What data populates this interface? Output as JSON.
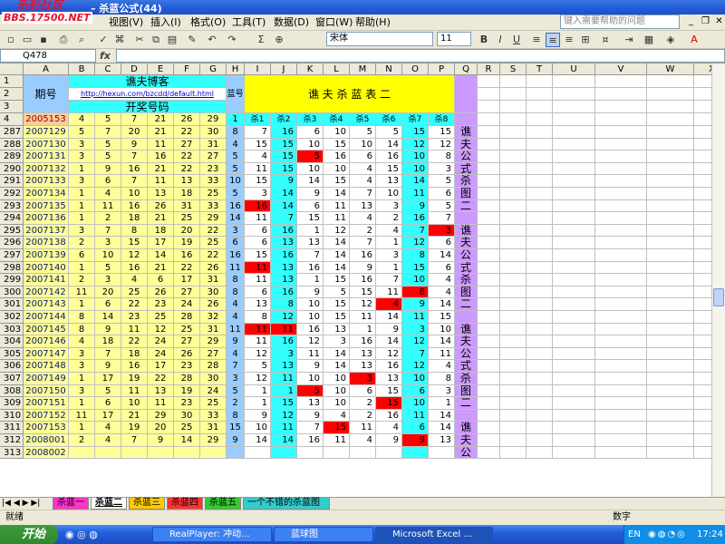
{
  "window": {
    "title": "– 杀蓝公式(44)"
  },
  "logo": {
    "line1": "乐彩社区",
    "line2": "BBS.17500.NET"
  },
  "menu": [
    {
      "id": "view",
      "label": "视图(V)"
    },
    {
      "id": "insert",
      "label": "插入(I)"
    },
    {
      "id": "format",
      "label": "格式(O)"
    },
    {
      "id": "tools",
      "label": "工具(T)"
    },
    {
      "id": "data",
      "label": "数据(D)"
    },
    {
      "id": "window",
      "label": "窗口(W)"
    },
    {
      "id": "help",
      "label": "帮助(H)"
    }
  ],
  "help_placeholder": "键入需要帮助的问题",
  "font_name": "宋体",
  "font_size": "11",
  "name_box": "Q478",
  "fx_label": "fx",
  "columns": [
    "A",
    "B",
    "C",
    "D",
    "E",
    "F",
    "G",
    "H",
    "I",
    "J",
    "K",
    "L",
    "M",
    "N",
    "O",
    "P",
    "Q",
    "R",
    "S",
    "T",
    "U",
    "V",
    "W",
    "X"
  ],
  "header": {
    "period": "期号",
    "blog_title": "谯夫博客",
    "blog_url": "http://hexun.com/bzcdd/default.html",
    "draw_numbers": "开奖号码",
    "blue": "蓝号",
    "table_title": "谯 夫 杀 蓝 表 二",
    "row_labels": [
      "1",
      "2",
      "3",
      "4"
    ]
  },
  "row4": {
    "row": "4",
    "period": "2005153",
    "nums": [
      "4",
      "5",
      "7",
      "21",
      "26",
      "29"
    ],
    "blue": "1",
    "kill_headers": [
      "杀1",
      "杀2",
      "杀3",
      "杀4",
      "杀5",
      "杀6",
      "杀7",
      "杀8"
    ]
  },
  "rows": [
    {
      "row": "287",
      "period": "2007129",
      "nums": [
        "5",
        "7",
        "20",
        "21",
        "22",
        "30"
      ],
      "blue": "8",
      "kills": [
        "7",
        "16",
        "6",
        "10",
        "5",
        "5",
        "15",
        "15"
      ],
      "red": []
    },
    {
      "row": "288",
      "period": "2007130",
      "nums": [
        "3",
        "5",
        "9",
        "11",
        "27",
        "31"
      ],
      "blue": "4",
      "kills": [
        "15",
        "15",
        "10",
        "15",
        "10",
        "14",
        "12",
        "12"
      ],
      "red": []
    },
    {
      "row": "289",
      "period": "2007131",
      "nums": [
        "3",
        "5",
        "7",
        "16",
        "22",
        "27"
      ],
      "blue": "5",
      "kills": [
        "4",
        "15",
        "5",
        "16",
        "6",
        "16",
        "10",
        "8"
      ],
      "red": [
        2
      ]
    },
    {
      "row": "290",
      "period": "2007132",
      "nums": [
        "1",
        "9",
        "16",
        "21",
        "22",
        "23"
      ],
      "blue": "5",
      "kills": [
        "11",
        "15",
        "10",
        "10",
        "4",
        "15",
        "10",
        "3"
      ],
      "red": []
    },
    {
      "row": "291",
      "period": "2007133",
      "nums": [
        "3",
        "6",
        "7",
        "11",
        "13",
        "33"
      ],
      "blue": "10",
      "kills": [
        "15",
        "9",
        "14",
        "15",
        "4",
        "13",
        "14",
        "5"
      ],
      "red": []
    },
    {
      "row": "292",
      "period": "2007134",
      "nums": [
        "1",
        "4",
        "10",
        "13",
        "18",
        "25"
      ],
      "blue": "5",
      "kills": [
        "3",
        "14",
        "9",
        "14",
        "7",
        "10",
        "11",
        "6"
      ],
      "red": []
    },
    {
      "row": "293",
      "period": "2007135",
      "nums": [
        "1",
        "11",
        "16",
        "26",
        "31",
        "33"
      ],
      "blue": "16",
      "kills": [
        "16",
        "14",
        "6",
        "11",
        "13",
        "3",
        "9",
        "5"
      ],
      "red": [
        0
      ]
    },
    {
      "row": "294",
      "period": "2007136",
      "nums": [
        "1",
        "2",
        "18",
        "21",
        "25",
        "29"
      ],
      "blue": "14",
      "kills": [
        "11",
        "7",
        "15",
        "11",
        "4",
        "2",
        "16",
        "7"
      ],
      "red": []
    },
    {
      "row": "295",
      "period": "2007137",
      "nums": [
        "3",
        "7",
        "8",
        "18",
        "20",
        "22"
      ],
      "blue": "3",
      "kills": [
        "6",
        "16",
        "1",
        "12",
        "2",
        "4",
        "7",
        "3"
      ],
      "red": [
        7
      ]
    },
    {
      "row": "296",
      "period": "2007138",
      "nums": [
        "2",
        "3",
        "15",
        "17",
        "19",
        "25"
      ],
      "blue": "6",
      "kills": [
        "6",
        "13",
        "13",
        "14",
        "7",
        "1",
        "12",
        "6"
      ],
      "red": []
    },
    {
      "row": "297",
      "period": "2007139",
      "nums": [
        "6",
        "10",
        "12",
        "14",
        "16",
        "22"
      ],
      "blue": "16",
      "kills": [
        "15",
        "16",
        "7",
        "14",
        "16",
        "3",
        "8",
        "14"
      ],
      "red": []
    },
    {
      "row": "298",
      "period": "2007140",
      "nums": [
        "1",
        "5",
        "16",
        "21",
        "22",
        "26"
      ],
      "blue": "11",
      "kills": [
        "11",
        "13",
        "16",
        "14",
        "9",
        "1",
        "15",
        "6"
      ],
      "red": [
        0
      ]
    },
    {
      "row": "299",
      "period": "2007141",
      "nums": [
        "2",
        "3",
        "4",
        "6",
        "17",
        "31"
      ],
      "blue": "8",
      "kills": [
        "11",
        "13",
        "1",
        "15",
        "16",
        "7",
        "10",
        "4"
      ],
      "red": []
    },
    {
      "row": "300",
      "period": "2007142",
      "nums": [
        "11",
        "20",
        "25",
        "26",
        "27",
        "30"
      ],
      "blue": "8",
      "kills": [
        "6",
        "16",
        "9",
        "5",
        "15",
        "11",
        "8",
        "4"
      ],
      "red": [
        6
      ]
    },
    {
      "row": "301",
      "period": "2007143",
      "nums": [
        "1",
        "6",
        "22",
        "23",
        "24",
        "26"
      ],
      "blue": "4",
      "kills": [
        "13",
        "8",
        "10",
        "15",
        "12",
        "4",
        "9",
        "14"
      ],
      "red": [
        5
      ]
    },
    {
      "row": "302",
      "period": "2007144",
      "nums": [
        "8",
        "14",
        "23",
        "25",
        "28",
        "32"
      ],
      "blue": "4",
      "kills": [
        "8",
        "12",
        "10",
        "15",
        "11",
        "14",
        "11",
        "15"
      ],
      "red": []
    },
    {
      "row": "303",
      "period": "2007145",
      "nums": [
        "8",
        "9",
        "11",
        "12",
        "25",
        "31"
      ],
      "blue": "11",
      "kills": [
        "11",
        "11",
        "16",
        "13",
        "1",
        "9",
        "3",
        "10"
      ],
      "red": [
        0,
        1
      ]
    },
    {
      "row": "304",
      "period": "2007146",
      "nums": [
        "4",
        "18",
        "22",
        "24",
        "27",
        "29"
      ],
      "blue": "9",
      "kills": [
        "11",
        "16",
        "12",
        "3",
        "16",
        "14",
        "12",
        "14"
      ],
      "red": []
    },
    {
      "row": "305",
      "period": "2007147",
      "nums": [
        "3",
        "7",
        "18",
        "24",
        "26",
        "27"
      ],
      "blue": "4",
      "kills": [
        "12",
        "3",
        "11",
        "14",
        "13",
        "12",
        "7",
        "11"
      ],
      "red": []
    },
    {
      "row": "306",
      "period": "2007148",
      "nums": [
        "3",
        "9",
        "16",
        "17",
        "23",
        "28"
      ],
      "blue": "7",
      "kills": [
        "5",
        "13",
        "9",
        "14",
        "13",
        "16",
        "12",
        "4"
      ],
      "red": []
    },
    {
      "row": "307",
      "period": "2007149",
      "nums": [
        "1",
        "17",
        "19",
        "22",
        "28",
        "30"
      ],
      "blue": "3",
      "kills": [
        "12",
        "11",
        "10",
        "10",
        "3",
        "13",
        "10",
        "8"
      ],
      "red": [
        4
      ]
    },
    {
      "row": "308",
      "period": "2007150",
      "nums": [
        "3",
        "5",
        "11",
        "13",
        "19",
        "24"
      ],
      "blue": "5",
      "kills": [
        "1",
        "1",
        "5",
        "10",
        "6",
        "15",
        "6",
        "3"
      ],
      "red": [
        2
      ]
    },
    {
      "row": "309",
      "period": "2007151",
      "nums": [
        "1",
        "6",
        "10",
        "11",
        "23",
        "25"
      ],
      "blue": "2",
      "kills": [
        "1",
        "15",
        "13",
        "10",
        "2",
        "15",
        "10",
        "1"
      ],
      "red": [
        5
      ]
    },
    {
      "row": "310",
      "period": "2007152",
      "nums": [
        "11",
        "17",
        "21",
        "29",
        "30",
        "33"
      ],
      "blue": "8",
      "kills": [
        "9",
        "12",
        "9",
        "4",
        "2",
        "16",
        "11",
        "14"
      ],
      "red": []
    },
    {
      "row": "311",
      "period": "2007153",
      "nums": [
        "1",
        "4",
        "19",
        "20",
        "25",
        "31"
      ],
      "blue": "15",
      "kills": [
        "10",
        "11",
        "7",
        "15",
        "11",
        "4",
        "6",
        "14"
      ],
      "red": [
        3
      ]
    },
    {
      "row": "312",
      "period": "2008001",
      "nums": [
        "2",
        "4",
        "7",
        "9",
        "14",
        "29"
      ],
      "blue": "9",
      "kills": [
        "14",
        "14",
        "16",
        "11",
        "4",
        "9",
        "9",
        "13"
      ],
      "red": [
        6
      ]
    },
    {
      "row": "313",
      "period": "2008002",
      "nums": [
        "",
        "",
        "",
        "",
        "",
        "",
        ""
      ],
      "blue": "",
      "kills": [
        "",
        "",
        "",
        "",
        "",
        "",
        "",
        ""
      ],
      "red": []
    }
  ],
  "side_text": [
    "谯",
    "夫",
    "公",
    "式",
    "杀",
    "图",
    "二",
    "",
    "谯",
    "夫",
    "公",
    "式",
    "杀",
    "图",
    "二",
    "",
    "谯",
    "夫",
    "公",
    "式",
    "杀",
    "图",
    "二",
    "",
    "谯",
    "夫",
    "公"
  ],
  "sheet_tabs": [
    {
      "label": "杀蓝一",
      "color": "#ff33cc"
    },
    {
      "label": "杀蓝二",
      "color": "#ffffff"
    },
    {
      "label": "杀蓝三",
      "color": "#ffcc00"
    },
    {
      "label": "杀蓝四",
      "color": "#ff3333"
    },
    {
      "label": "杀蓝五",
      "color": "#33cc33"
    },
    {
      "label": "一个不错的杀蓝图",
      "color": "#33cccc"
    }
  ],
  "status": {
    "left": "就绪",
    "right": "数字"
  },
  "taskbar": {
    "start": "开始",
    "tasks": [
      {
        "label": "RealPlayer: 冲动..."
      },
      {
        "label": "蓝球图"
      },
      {
        "label": "Microsoft Excel ..."
      }
    ],
    "lang": "EN",
    "clock": "17:24"
  },
  "colors": {
    "yellow": "#ffff99",
    "cyan": "#33ffff",
    "teal": "#33cccc",
    "violet": "#cc99ff",
    "red": "#ff0000",
    "header_blue": "#99ccff",
    "title_yellow": "#ffff00"
  }
}
